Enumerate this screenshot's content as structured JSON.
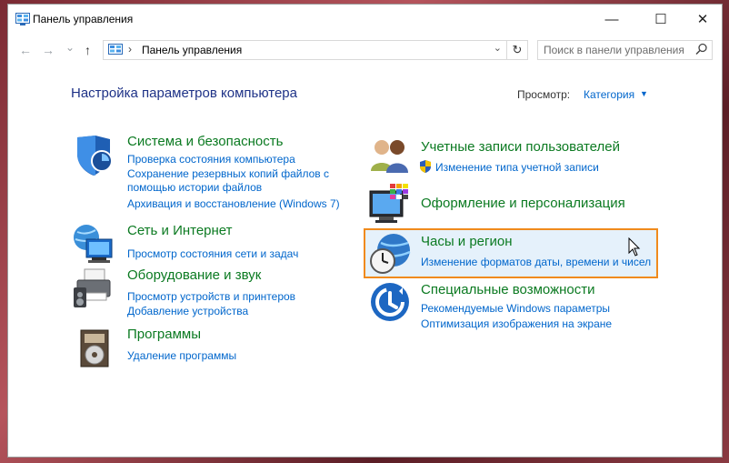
{
  "window": {
    "title": "Панель управления",
    "controls": {
      "minimize": "—",
      "maximize": "☐",
      "close": "✕"
    }
  },
  "nav": {
    "back": "←",
    "forward": "→",
    "recent": "⌄",
    "up": "↑"
  },
  "address": {
    "separator": "›",
    "path": "Панель управления",
    "dropdown": "⌄",
    "refresh": "↻"
  },
  "search": {
    "placeholder": "Поиск в панели управления"
  },
  "main": {
    "heading": "Настройка параметров компьютера",
    "view_label": "Просмотр:",
    "view_value": "Категория",
    "view_caret": "▼"
  },
  "categories": [
    {
      "title": "Система и безопасность",
      "icon": "shield-icon",
      "links": [
        "Проверка состояния компьютера",
        "Сохранение резервных копий файлов с",
        "помощью истории файлов",
        "Архивация и восстановление (Windows 7)"
      ]
    },
    {
      "title": "Сеть и Интернет",
      "icon": "network-globe-icon",
      "links": [
        "Просмотр состояния сети и задач"
      ]
    },
    {
      "title": "Оборудование и звук",
      "icon": "printer-speaker-icon",
      "links": [
        "Просмотр устройств и принтеров",
        "Добавление устройства"
      ]
    },
    {
      "title": "Программы",
      "icon": "programs-disc-icon",
      "links": [
        "Удаление программы"
      ]
    },
    {
      "title": "Учетные записи пользователей",
      "icon": "users-icon",
      "links": [
        "Изменение типа учетной записи"
      ]
    },
    {
      "title": "Оформление и персонализация",
      "icon": "monitor-palette-icon",
      "links": []
    },
    {
      "title": "Часы и регион",
      "icon": "clock-globe-icon",
      "links": [
        "Изменение форматов даты, времени и чисел"
      ]
    },
    {
      "title": "Специальные возможности",
      "icon": "accessibility-icon",
      "links": [
        "Рекомендуемые Windows параметры",
        "Оптимизация изображения на экране"
      ]
    }
  ],
  "colors": {
    "link": "#0066cc",
    "category_title": "#0b7a21",
    "heading": "#1e3287",
    "highlight_border": "#f08a1c",
    "highlight_bg": "#e5f1fb"
  }
}
